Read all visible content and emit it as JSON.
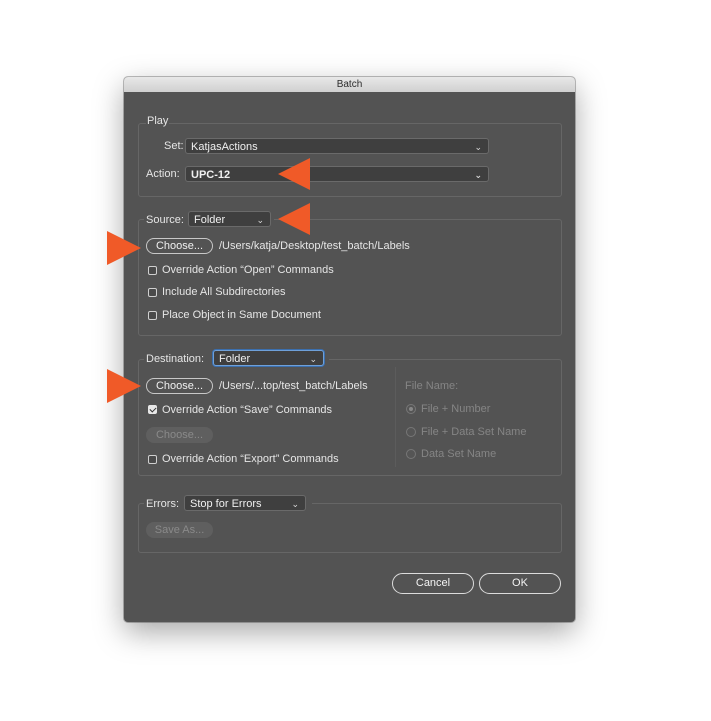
{
  "window": {
    "title": "Batch"
  },
  "play": {
    "legend": "Play",
    "set_label": "Set:",
    "set_value": "KatjasActions",
    "action_label": "Action:",
    "action_value": "UPC-12"
  },
  "source": {
    "label": "Source:",
    "value": "Folder",
    "choose_label": "Choose...",
    "path": "/Users/katja/Desktop/test_batch/Labels",
    "options": [
      {
        "label": "Override Action “Open” Commands",
        "checked": false
      },
      {
        "label": "Include All Subdirectories",
        "checked": false
      },
      {
        "label": "Place Object in Same Document",
        "checked": false
      }
    ]
  },
  "destination": {
    "label": "Destination:",
    "value": "Folder",
    "choose_label": "Choose...",
    "path": "/Users/...top/test_batch/Labels",
    "override_save_label": "Override Action “Save” Commands",
    "override_save_checked": true,
    "choose_disabled_label": "Choose...",
    "override_export_label": "Override Action “Export” Commands",
    "override_export_checked": false,
    "file_name_label": "File Name:",
    "file_name_options": [
      {
        "label": "File + Number",
        "selected": true
      },
      {
        "label": "File + Data Set Name",
        "selected": false
      },
      {
        "label": "Data Set Name",
        "selected": false
      }
    ]
  },
  "errors": {
    "label": "Errors:",
    "value": "Stop for Errors",
    "save_as_label": "Save As..."
  },
  "buttons": {
    "cancel": "Cancel",
    "ok": "OK"
  },
  "colors": {
    "dialog_bg": "#535353",
    "annotation_arrow": "#f05a28"
  },
  "icons": {
    "dropdown": "chevron-down-icon",
    "annotation": "arrow-annotation-icon"
  }
}
